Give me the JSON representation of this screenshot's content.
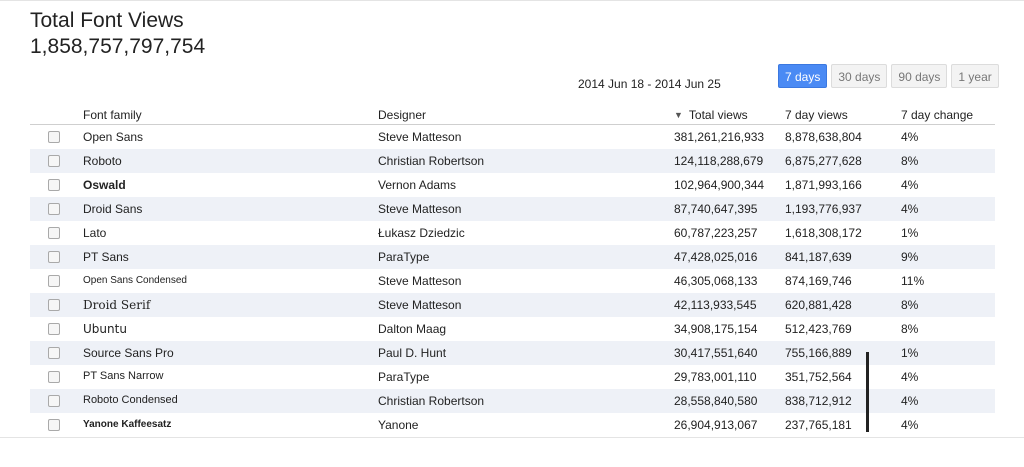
{
  "header": {
    "title": "Total Font Views",
    "total": "1,858,757,797,754"
  },
  "date_range": "2014 Jun 18 - 2014 Jun 25",
  "range_buttons": [
    {
      "label": "7 days",
      "active": true
    },
    {
      "label": "30 days",
      "active": false
    },
    {
      "label": "90 days",
      "active": false
    },
    {
      "label": "1 year",
      "active": false
    }
  ],
  "table": {
    "columns": {
      "font_family": "Font family",
      "designer": "Designer",
      "total_views": "Total views",
      "seven_day_views": "7 day views",
      "seven_day_change": "7 day change"
    },
    "sort_indicator": "▼",
    "rows": [
      {
        "font": "Open Sans",
        "designer": "Steve Matteson",
        "total": "381,261,216,933",
        "seven": "8,878,638,804",
        "change": "4%"
      },
      {
        "font": "Roboto",
        "designer": "Christian Robertson",
        "total": "124,118,288,679",
        "seven": "6,875,277,628",
        "change": "8%"
      },
      {
        "font": "Oswald",
        "designer": "Vernon Adams",
        "total": "102,964,900,344",
        "seven": "1,871,993,166",
        "change": "4%"
      },
      {
        "font": "Droid Sans",
        "designer": "Steve Matteson",
        "total": "87,740,647,395",
        "seven": "1,193,776,937",
        "change": "4%"
      },
      {
        "font": "Lato",
        "designer": "Łukasz Dziedzic",
        "total": "60,787,223,257",
        "seven": "1,618,308,172",
        "change": "1%"
      },
      {
        "font": "PT Sans",
        "designer": "ParaType",
        "total": "47,428,025,016",
        "seven": "841,187,639",
        "change": "9%"
      },
      {
        "font": "Open Sans Condensed",
        "designer": "Steve Matteson",
        "total": "46,305,068,133",
        "seven": "874,169,746",
        "change": "11%"
      },
      {
        "font": "Droid Serif",
        "designer": "Steve Matteson",
        "total": "42,113,933,545",
        "seven": "620,881,428",
        "change": "8%"
      },
      {
        "font": "Ubuntu",
        "designer": "Dalton Maag",
        "total": "34,908,175,154",
        "seven": "512,423,769",
        "change": "8%"
      },
      {
        "font": "Source Sans Pro",
        "designer": "Paul D. Hunt",
        "total": "30,417,551,640",
        "seven": "755,166,889",
        "change": "1%"
      },
      {
        "font": "PT Sans Narrow",
        "designer": "ParaType",
        "total": "29,783,001,110",
        "seven": "351,752,564",
        "change": "4%"
      },
      {
        "font": "Roboto Condensed",
        "designer": "Christian Robertson",
        "total": "28,558,840,580",
        "seven": "838,712,912",
        "change": "4%"
      },
      {
        "font": "Yanone Kaffeesatz",
        "designer": "Yanone",
        "total": "26,904,913,067",
        "seven": "237,765,181",
        "change": "4%"
      }
    ]
  }
}
